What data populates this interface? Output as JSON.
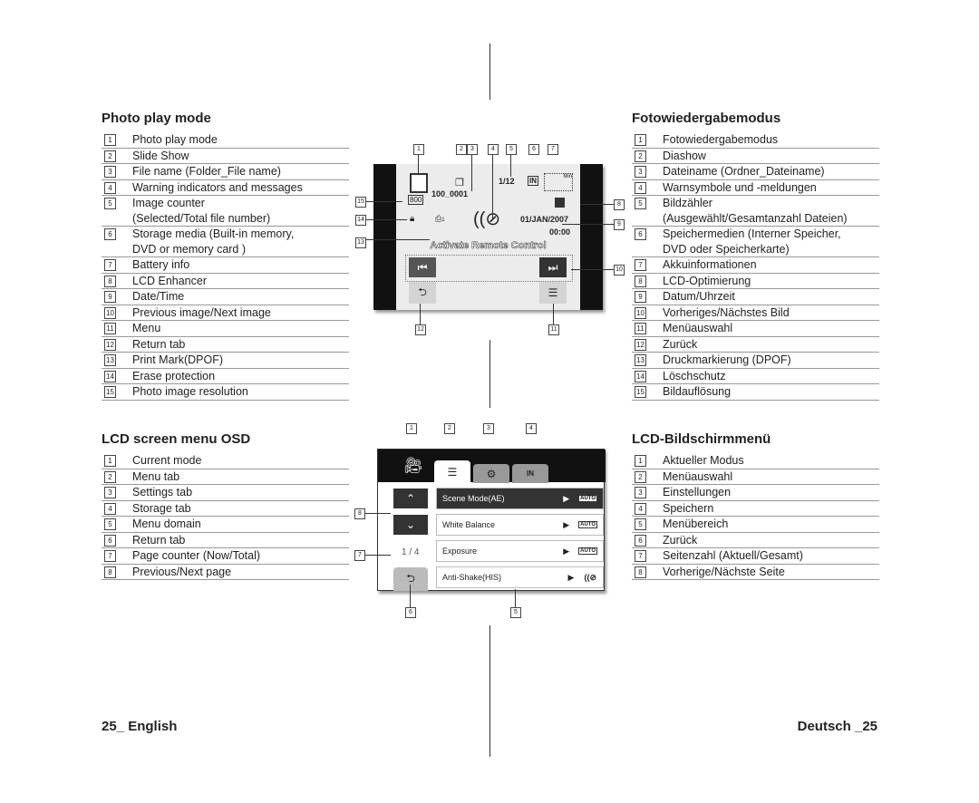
{
  "left": {
    "photo_heading": "Photo play mode",
    "photo_items": [
      {
        "n": "1",
        "lines": [
          "Photo play mode"
        ]
      },
      {
        "n": "2",
        "lines": [
          "Slide Show"
        ]
      },
      {
        "n": "3",
        "lines": [
          "File name (Folder_File name)"
        ]
      },
      {
        "n": "4",
        "lines": [
          "Warning indicators and messages"
        ]
      },
      {
        "n": "5",
        "lines": [
          "Image counter",
          "(Selected/Total file number)"
        ]
      },
      {
        "n": "6",
        "lines": [
          "Storage media (Built-in memory,",
          "DVD or memory card )"
        ]
      },
      {
        "n": "7",
        "lines": [
          "Battery info"
        ]
      },
      {
        "n": "8",
        "lines": [
          "LCD Enhancer"
        ]
      },
      {
        "n": "9",
        "lines": [
          "Date/Time"
        ]
      },
      {
        "n": "10",
        "lines": [
          "Previous image/Next image"
        ]
      },
      {
        "n": "11",
        "lines": [
          "Menu"
        ]
      },
      {
        "n": "12",
        "lines": [
          "Return tab"
        ]
      },
      {
        "n": "13",
        "lines": [
          "Print Mark(DPOF)"
        ]
      },
      {
        "n": "14",
        "lines": [
          "Erase protection"
        ]
      },
      {
        "n": "15",
        "lines": [
          "Photo image resolution"
        ]
      }
    ],
    "lcd_heading": "LCD screen menu OSD",
    "lcd_items": [
      {
        "n": "1",
        "lines": [
          "Current mode"
        ]
      },
      {
        "n": "2",
        "lines": [
          "Menu tab"
        ]
      },
      {
        "n": "3",
        "lines": [
          "Settings tab"
        ]
      },
      {
        "n": "4",
        "lines": [
          "Storage tab"
        ]
      },
      {
        "n": "5",
        "lines": [
          "Menu domain"
        ]
      },
      {
        "n": "6",
        "lines": [
          "Return tab"
        ]
      },
      {
        "n": "7",
        "lines": [
          "Page counter (Now/Total)"
        ]
      },
      {
        "n": "8",
        "lines": [
          "Previous/Next page"
        ]
      }
    ]
  },
  "right": {
    "photo_heading": "Fotowiedergabemodus",
    "photo_items": [
      {
        "n": "1",
        "lines": [
          "Fotowiedergabemodus"
        ]
      },
      {
        "n": "2",
        "lines": [
          "Diashow"
        ]
      },
      {
        "n": "3",
        "lines": [
          "Dateiname (Ordner_Dateiname)"
        ]
      },
      {
        "n": "4",
        "lines": [
          "Warnsymbole und -meldungen"
        ]
      },
      {
        "n": "5",
        "lines": [
          "Bildzähler",
          "(Ausgewählt/Gesamtanzahl Dateien)"
        ]
      },
      {
        "n": "6",
        "lines": [
          "Speichermedien (Interner Speicher,",
          "DVD oder Speicherkarte)"
        ]
      },
      {
        "n": "7",
        "lines": [
          "Akkuinformationen"
        ]
      },
      {
        "n": "8",
        "lines": [
          "LCD-Optimierung"
        ]
      },
      {
        "n": "9",
        "lines": [
          "Datum/Uhrzeit"
        ]
      },
      {
        "n": "10",
        "lines": [
          "Vorheriges/Nächstes Bild"
        ]
      },
      {
        "n": "11",
        "lines": [
          "Menüauswahl"
        ]
      },
      {
        "n": "12",
        "lines": [
          "Zurück"
        ]
      },
      {
        "n": "13",
        "lines": [
          "Druckmarkierung (DPOF)"
        ]
      },
      {
        "n": "14",
        "lines": [
          "Löschschutz"
        ]
      },
      {
        "n": "15",
        "lines": [
          "Bildauflösung"
        ]
      }
    ],
    "lcd_heading": "LCD-Bildschirmmenü",
    "lcd_items": [
      {
        "n": "1",
        "lines": [
          "Aktueller Modus"
        ]
      },
      {
        "n": "2",
        "lines": [
          "Menüauswahl"
        ]
      },
      {
        "n": "3",
        "lines": [
          "Einstellungen"
        ]
      },
      {
        "n": "4",
        "lines": [
          "Speichern"
        ]
      },
      {
        "n": "5",
        "lines": [
          "Menübereich"
        ]
      },
      {
        "n": "6",
        "lines": [
          "Zurück"
        ]
      },
      {
        "n": "7",
        "lines": [
          "Seitenzahl (Aktuell/Gesamt)"
        ]
      },
      {
        "n": "8",
        "lines": [
          "Vorherige/Nächste Seite"
        ]
      }
    ]
  },
  "photo_screen": {
    "file_name": "100_0001",
    "counter": "1/12",
    "resolution": "800",
    "storage": "IN",
    "date": "01/JAN/2007",
    "time": "00:00",
    "message": "Activate Remote Control",
    "print_count": "1",
    "battery_label": "Min",
    "callouts": [
      "1",
      "2",
      "3",
      "4",
      "5",
      "6",
      "7",
      "8",
      "9",
      "10",
      "11",
      "12",
      "13",
      "14",
      "15"
    ]
  },
  "menu_screen": {
    "page_counter": "1 / 4",
    "storage_tab": "IN",
    "items": [
      {
        "label": "Scene Mode(AE)",
        "value": "AUTO"
      },
      {
        "label": "White Balance",
        "value": "AUTO"
      },
      {
        "label": "Exposure",
        "value": "AUTO"
      },
      {
        "label": "Anti-Shake(HIS)",
        "value": ""
      }
    ],
    "callouts": [
      "1",
      "2",
      "3",
      "4",
      "5",
      "6",
      "7",
      "8"
    ]
  },
  "footer": {
    "left": "25_ English",
    "right": "Deutsch _25"
  }
}
